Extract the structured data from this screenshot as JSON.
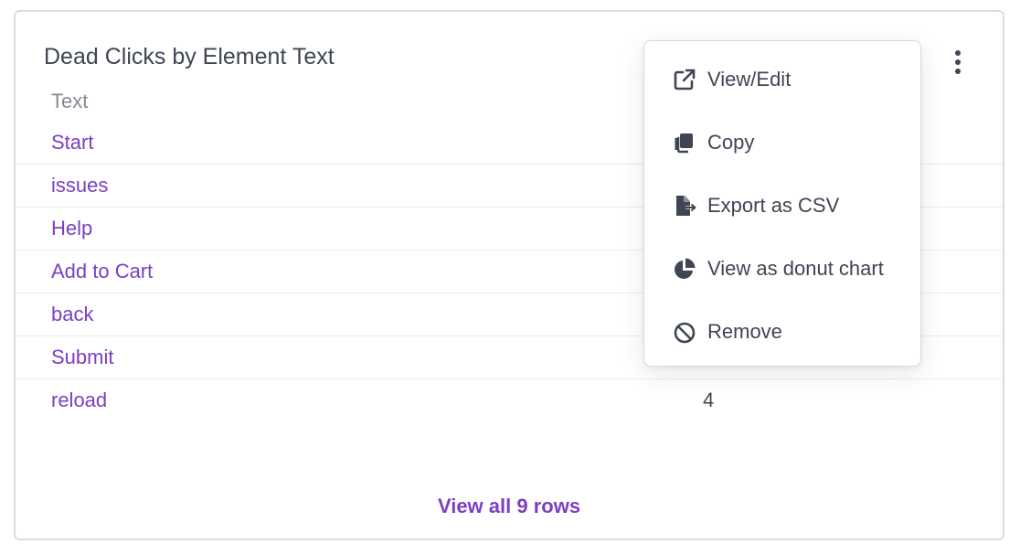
{
  "card": {
    "title": "Dead Clicks by Element Text",
    "column_header": "Text",
    "rows": [
      {
        "text": "Start",
        "value": ""
      },
      {
        "text": "issues",
        "value": ""
      },
      {
        "text": "Help",
        "value": ""
      },
      {
        "text": "Add to Cart",
        "value": ""
      },
      {
        "text": "back",
        "value": ""
      },
      {
        "text": "Submit",
        "value": ""
      },
      {
        "text": "reload",
        "value": "4"
      }
    ],
    "view_all_label": "View all 9 rows",
    "more_icon": "kebab-vertical-icon"
  },
  "menu": {
    "items": [
      {
        "label": "View/Edit",
        "icon": "external-link-icon"
      },
      {
        "label": "Copy",
        "icon": "copy-icon"
      },
      {
        "label": "Export as CSV",
        "icon": "file-export-icon"
      },
      {
        "label": "View as donut chart",
        "icon": "pie-chart-icon"
      },
      {
        "label": "Remove",
        "icon": "ban-icon"
      }
    ]
  },
  "colors": {
    "link": "#7b3fc3",
    "text": "#3f4552",
    "muted": "#868a96",
    "border": "#dcdde3"
  }
}
